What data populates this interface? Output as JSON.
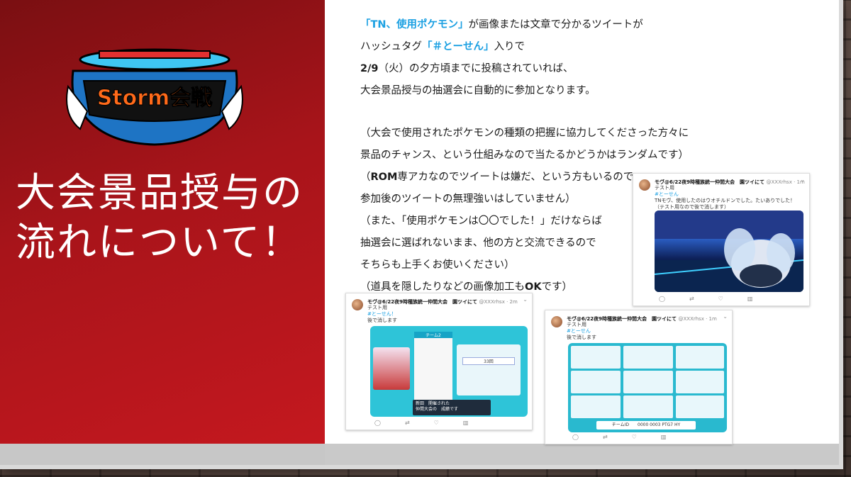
{
  "slide": {
    "title_lines": [
      "大会景品授与の",
      "流れについて！"
    ],
    "logo_text": "Storm会戦"
  },
  "body": {
    "l1_hl": "「TN、使用ポケモン」",
    "l1_rest": "が画像または文章で分かるツイートが",
    "l2_a": "ハッシュタグ",
    "l2_hl": "「＃とーせん」",
    "l2_b": "入りで",
    "l3_bold": "2/9",
    "l3_rest": "（火）の夕方頃までに投稿されていれば、",
    "l4": "大会景品授与の抽選会に自動的に参加となります。",
    "l5": "（大会で使用されたポケモンの種類の把握に協力してくださった方々に",
    "l6": "景品のチャンス、という仕組みなので当たるかどうかはランダムです）",
    "l7_a": "（",
    "l7_bold": "ROM",
    "l7_b": "専アカなのでツイートは嫌だ、という方もいるので",
    "l8": "参加後のツイートの無理強いはしていません）",
    "l9": "（また、「使用ポケモンは〇〇でした！」だけならば",
    "l10": "抽選会に選ばれないまま、他の方と交流できるので",
    "l11": "そちらも上手くお使いください）",
    "l12_a": "（道具を隠したりなどの画像加工も",
    "l12_bold": "OK",
    "l12_b": "です）"
  },
  "tweets": [
    {
      "name": "モヴ@6/22夜9時種族統一仲間大会　園ツイにて",
      "handle": "@XXXrhsx · 1m",
      "lines": [
        "テスト用",
        "#とーせん",
        "TNモヴ、使用したのはウオチルドンでした。たいありでした！",
        "（テスト用なので後で消します）"
      ]
    },
    {
      "name": "モヴ@6/22夜9時種族統一仲間大会　園ツイにて",
      "handle": "@XXXrhsx · 2m",
      "lines": [
        "テスト用",
        "#とーせん！",
        "後で消します"
      ],
      "media_team_label": "チーム2",
      "media_vs_text": "33回",
      "media_caption": [
        "新田　開催された",
        "仲間大会の　成績です"
      ]
    },
    {
      "name": "モヴ@6/22夜9時種族統一仲間大会　園ツイにて",
      "handle": "@XXXrhsx · 1m",
      "lines": [
        "テスト用",
        "#とーせん",
        "後で消します"
      ],
      "media_footer": "チームID　　0000  0003  PTG7  HY"
    }
  ],
  "colors": {
    "accent": "#1ba0e2",
    "left_panel": "#a8141a"
  }
}
